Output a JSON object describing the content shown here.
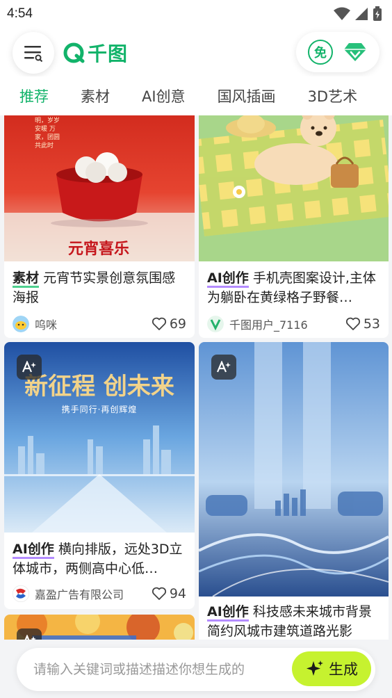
{
  "status": {
    "time": "4:54"
  },
  "header": {
    "brand": "千图",
    "free_label": "免"
  },
  "tabs": [
    "推荐",
    "素材",
    "AI创意",
    "国风插画",
    "3D艺术"
  ],
  "cards": [
    {
      "kw": "素材",
      "title": "元宵节实景创意氛围感海报",
      "author": "呜咪",
      "likes": "69",
      "poster_text": "元宵喜乐",
      "poster_side": "明，岁岁安暖 万家，团圆共此时"
    },
    {
      "kw": "AI创作",
      "title": "手机壳图案设计,主体为躺卧在黄绿格子野餐…",
      "author": "千图用户_7116",
      "likes": "53"
    },
    {
      "kw": "AI创作",
      "title": "横向排版，远处3D立体城市，两侧高中心低…",
      "author": "嘉盈广告有限公司",
      "likes": "94",
      "poster_text": "新征程 创未来",
      "poster_sub": "携手同行·再创辉煌"
    },
    {
      "kw": "AI创作",
      "title": "科技感未来城市背景简约风城市建筑道路光影"
    }
  ],
  "search": {
    "placeholder": "请输入关键词或描述描述你想生成的",
    "button": "生成"
  },
  "colors": {
    "brand_green": "#12b36a",
    "generate_yellow": "#c6f22f"
  }
}
